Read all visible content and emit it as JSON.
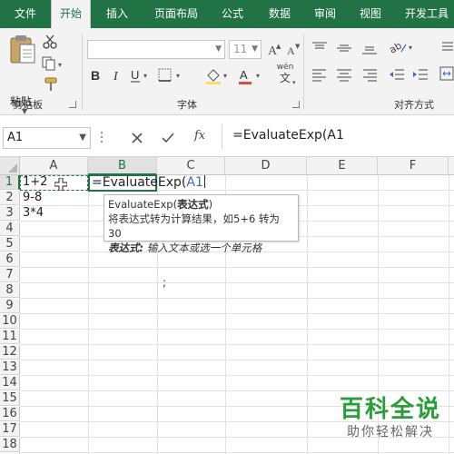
{
  "ribbon": {
    "tabs": [
      {
        "label": "文件",
        "active": false
      },
      {
        "label": "开始",
        "active": true
      },
      {
        "label": "插入",
        "active": false
      },
      {
        "label": "页面布局",
        "active": false
      },
      {
        "label": "公式",
        "active": false
      },
      {
        "label": "数据",
        "active": false
      },
      {
        "label": "审阅",
        "active": false
      },
      {
        "label": "视图",
        "active": false
      },
      {
        "label": "开发工具",
        "active": false
      }
    ],
    "paste_label": "粘贴",
    "groups": {
      "clipboard": "剪贴板",
      "font": "字体",
      "alignment": "对齐方式"
    },
    "font_size": "11",
    "phonetic_icon_text": "wén",
    "phonetic_icon_char": "文"
  },
  "formula_bar": {
    "name_box": "A1",
    "fx_label": "fx",
    "content": "=EvaluateExp(A1"
  },
  "grid": {
    "columns": [
      "A",
      "B",
      "C",
      "D",
      "E",
      "F"
    ],
    "rows": [
      "1",
      "2",
      "3",
      "4",
      "5",
      "6",
      "7",
      "8",
      "9",
      "10",
      "11",
      "12",
      "13",
      "14",
      "15",
      "16",
      "17",
      "18",
      "19"
    ],
    "cells": {
      "A1": "1+2",
      "A2": "9-8",
      "A3": "3*4"
    },
    "editing": {
      "prefix": "=EvaluateExp(",
      "ref": "A1"
    },
    "stray_char": ";"
  },
  "tooltip": {
    "func_name": "EvaluateExp(",
    "param": "表达式",
    "close": ")",
    "description": "将表达式转为计算结果，如5+6 转为 30",
    "param_label": "表达式:",
    "param_desc": " 输入文本或选一个单元格"
  },
  "watermark": {
    "title": "百科全说",
    "subtitle": "助你轻松解决"
  },
  "colors": {
    "excel_green": "#217346",
    "reference_blue": "#3b6cb7",
    "watermark_green": "#2a9d3a"
  }
}
